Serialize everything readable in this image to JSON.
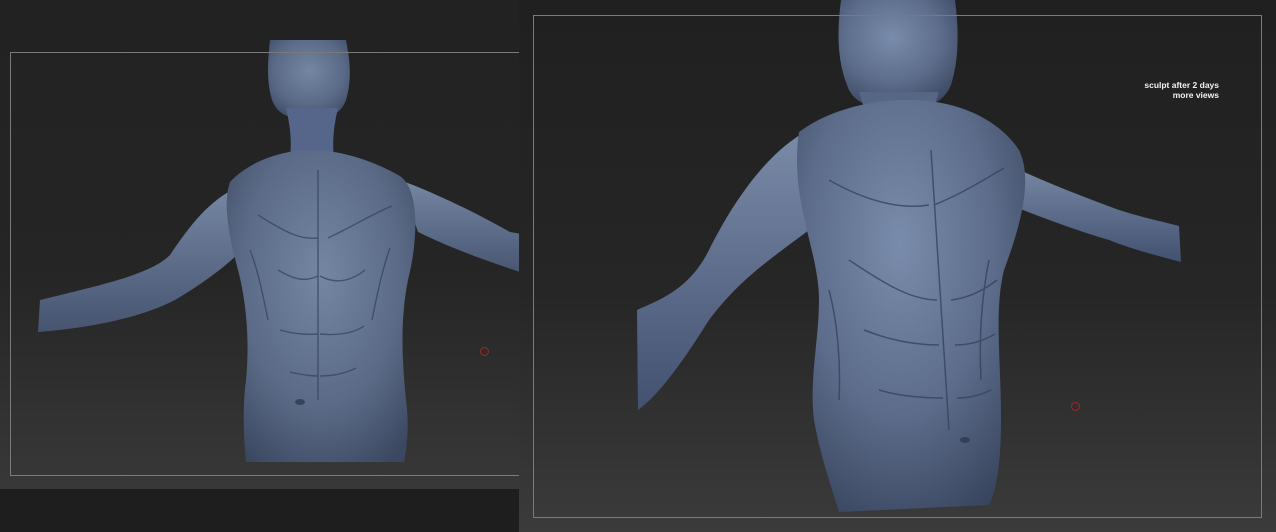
{
  "canvas": {
    "background": "#1e1e1e",
    "model_color": "#5a6a86",
    "model_highlight": "#7c8ca8",
    "model_shadow": "#3a4660",
    "frame_color": "#7a7a7a",
    "marker_color": "#a0262a"
  },
  "views": [
    {
      "name": "front-view",
      "marker_icon": "circle-marker-icon"
    },
    {
      "name": "three-quarter-view",
      "marker_icon": "circle-marker-icon"
    }
  ],
  "caption": {
    "line1": "sculpt after 2 days",
    "line2": "more views"
  }
}
